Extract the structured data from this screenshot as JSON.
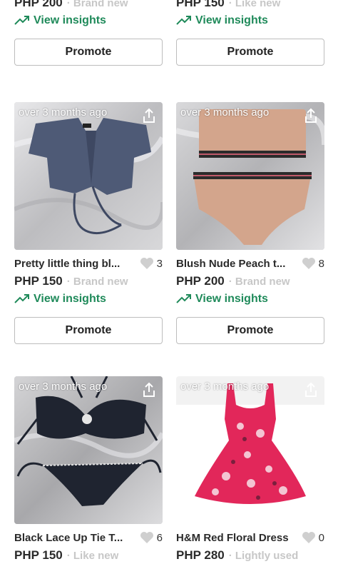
{
  "top_cards": [
    {
      "price": "PHP 200",
      "condition": "· Brand new",
      "insights": "View insights",
      "promote": "Promote"
    },
    {
      "price": "PHP 150",
      "condition": "· Like new",
      "insights": "View insights",
      "promote": "Promote"
    }
  ],
  "mid_cards": [
    {
      "time": "over 3 months ago",
      "title": "Pretty little thing bl...",
      "likes": "3",
      "price": "PHP 150",
      "condition": "· Brand new",
      "insights": "View insights",
      "promote": "Promote"
    },
    {
      "time": "over 3 months ago",
      "title": "Blush Nude Peach t...",
      "likes": "8",
      "price": "PHP 200",
      "condition": "· Brand new",
      "insights": "View insights",
      "promote": "Promote"
    }
  ],
  "bottom_cards": [
    {
      "time": "over 3 months ago",
      "title": "Black Lace Up Tie T...",
      "likes": "6",
      "price": "PHP 150",
      "condition": "· Like new"
    },
    {
      "time": "over 3 months ago",
      "title": "H&M Red Floral Dress",
      "likes": "0",
      "price": "PHP 280",
      "condition": "· Lightly used"
    }
  ],
  "icons": {
    "insights": "trending-up-icon",
    "share": "share-icon",
    "like": "heart-icon"
  },
  "colors": {
    "insights": "#1f8a5a",
    "condition": "#c7c7c7",
    "heart": "#cfcfcf"
  }
}
